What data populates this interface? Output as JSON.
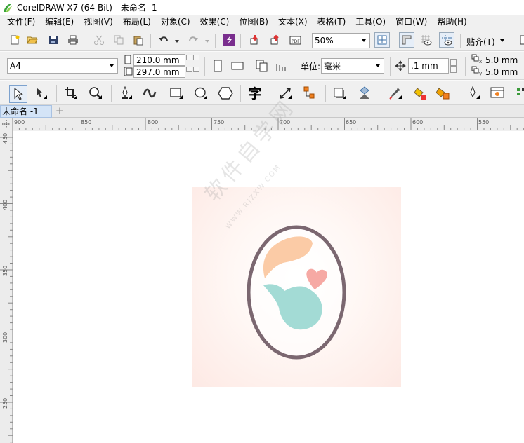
{
  "window": {
    "title": "CorelDRAW X7 (64-Bit) - 未命名 -1"
  },
  "menu": [
    "文件(F)",
    "编辑(E)",
    "视图(V)",
    "布局(L)",
    "对象(C)",
    "效果(C)",
    "位图(B)",
    "文本(X)",
    "表格(T)",
    "工具(O)",
    "窗口(W)",
    "帮助(H)"
  ],
  "toolbar": {
    "zoom_value": "50%",
    "snap_label": "贴齐(T)"
  },
  "property_bar": {
    "page_size": "A4",
    "width": "210.0 mm",
    "height": "297.0 mm",
    "units_label": "单位:",
    "units_value": "毫米",
    "nudge": ".1 mm",
    "dup_x": "5.0 mm",
    "dup_y": "5.0 mm",
    "dup_x_label": "x",
    "dup_y_label": "y"
  },
  "tools": {
    "text_tool_glyph": "字"
  },
  "document_tab": {
    "label": "未命名 -1",
    "add_symbol": "+"
  },
  "ruler": {
    "horizontal": [
      "900",
      "850",
      "800",
      "750",
      "700",
      "650",
      "600",
      "550"
    ],
    "vertical": [
      "450",
      "400",
      "350",
      "300",
      "250"
    ]
  },
  "watermark": {
    "text": "软件自学网",
    "sub": "WWW.RJZXW.COM"
  },
  "colors": {
    "oval_stroke": "#7b6770",
    "head": "#fbcba6",
    "heart": "#f6a9a4",
    "body": "#a3dbd5",
    "accent_purple": "#7a2e8e"
  }
}
